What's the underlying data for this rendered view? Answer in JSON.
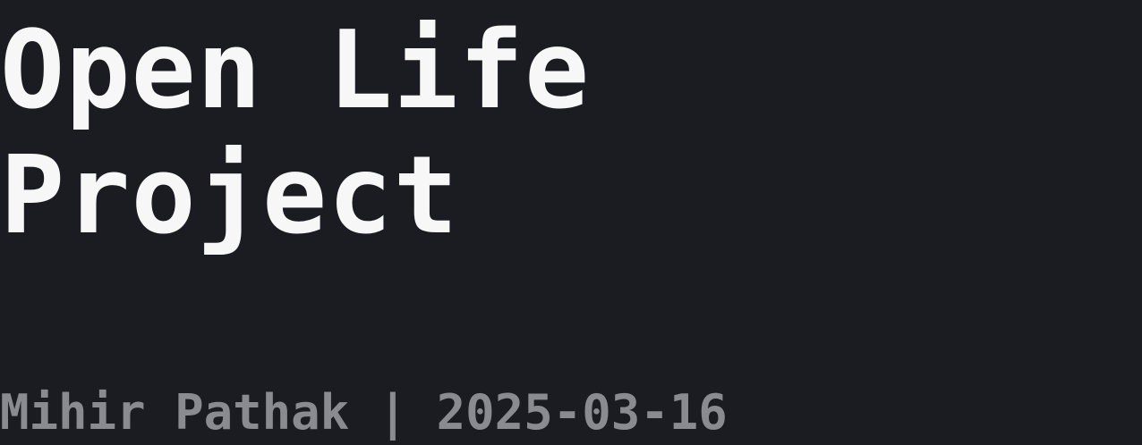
{
  "page": {
    "title_lines": [
      "Open Life",
      "Project"
    ],
    "byline": "Mihir Pathak | 2025-03-16"
  },
  "colors": {
    "background": "#1b1c21",
    "title": "#f7f7f7",
    "byline": "#8a8b90"
  }
}
